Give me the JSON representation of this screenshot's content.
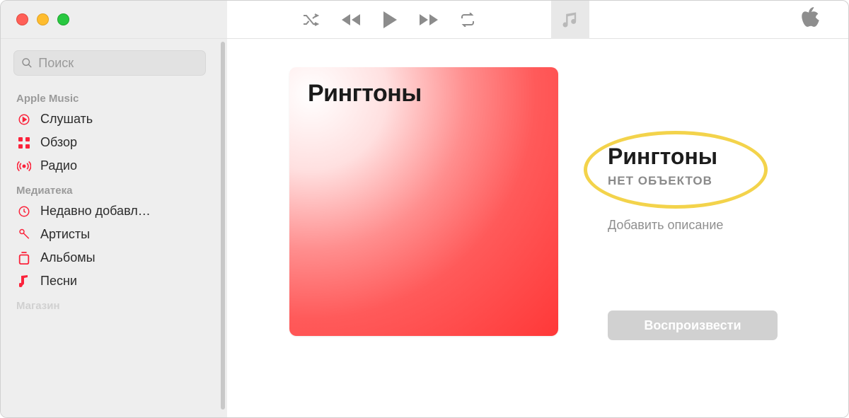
{
  "search": {
    "placeholder": "Поиск"
  },
  "sidebar": {
    "sections": [
      {
        "title": "Apple Music",
        "items": [
          {
            "icon": "play-circle",
            "label": "Слушать"
          },
          {
            "icon": "grid",
            "label": "Обзор"
          },
          {
            "icon": "radio",
            "label": "Радио"
          }
        ]
      },
      {
        "title": "Медиатека",
        "items": [
          {
            "icon": "clock",
            "label": "Недавно добавл…"
          },
          {
            "icon": "mic",
            "label": "Артисты"
          },
          {
            "icon": "album",
            "label": "Альбомы"
          },
          {
            "icon": "note",
            "label": "Песни"
          }
        ]
      },
      {
        "title": "Магазин",
        "items": []
      }
    ]
  },
  "playlist": {
    "cover_title": "Рингтоны",
    "title": "Рингтоны",
    "subtitle": "НЕТ ОБЪЕКТОВ",
    "description_placeholder": "Добавить описание",
    "play_label": "Воспроизвести"
  }
}
